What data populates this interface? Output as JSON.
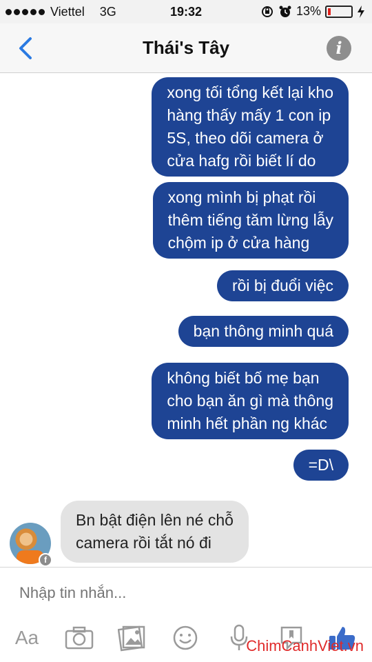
{
  "status_bar": {
    "carrier": "Viettel",
    "network": "3G",
    "time": "19:32",
    "battery": "13%",
    "battery_level": 0.13
  },
  "nav": {
    "title": "Thái's Tây"
  },
  "messages": [
    {
      "direction": "outgoing",
      "text": "xong tối tổng kết lại kho\nhàng thấy mấy 1 con ip\n5S, theo dõi camera ở\ncửa hafg rồi biết lí do"
    },
    {
      "direction": "outgoing",
      "text": "xong mình bị phạt rồi\nthêm tiếng tăm lừng lẫy\nchộm ip ở cửa hàng"
    },
    {
      "direction": "outgoing",
      "text": "rồi bị đuổi việc"
    },
    {
      "direction": "outgoing",
      "text": "bạn thông minh quá"
    },
    {
      "direction": "outgoing",
      "text": "không biết bố mẹ bạn\ncho bạn ăn gì mà thông\nminh hết phần ng khác"
    },
    {
      "direction": "outgoing",
      "text": "=D\\"
    },
    {
      "direction": "incoming",
      "text": "Bn bật điện lên né chỗ\ncamera rồi tắt nó đi"
    }
  ],
  "composer": {
    "placeholder": "Nhập tin nhắn...",
    "text_button": "Aa"
  },
  "colors": {
    "outgoing_bubble": "#1e4494",
    "incoming_bubble": "#e3e3e3",
    "ios_blue": "#2a7ae2"
  },
  "watermark": "ChimCanhViet.vn"
}
